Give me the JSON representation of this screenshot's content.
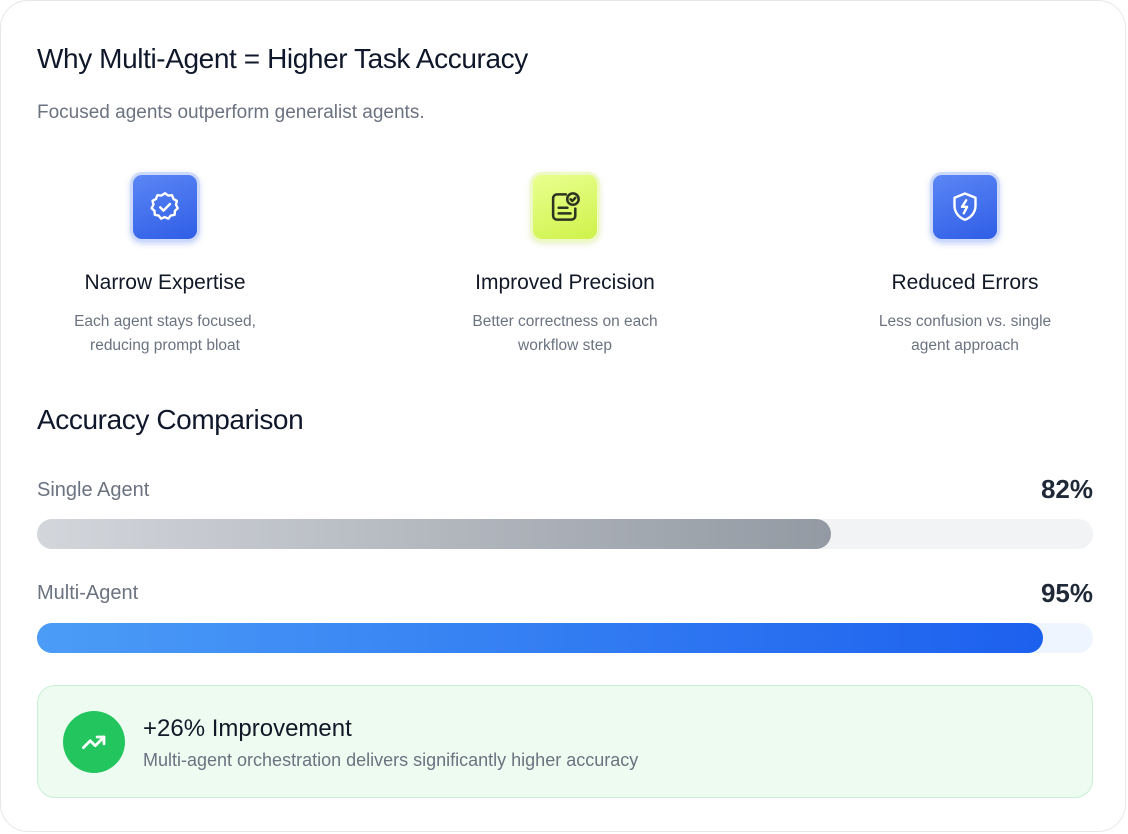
{
  "header": {
    "title": "Why Multi-Agent = Higher Task Accuracy",
    "subtitle": "Focused agents outperform generalist agents."
  },
  "features": [
    {
      "icon": "badge-check-icon",
      "title": "Narrow Expertise",
      "desc_line1": "Each agent stays focused,",
      "desc_line2": "reducing prompt bloat",
      "icon_bg": "#3f6ff0"
    },
    {
      "icon": "document-check-icon",
      "title": "Improved Precision",
      "desc_line1": "Better correctness on each",
      "desc_line2": "workflow step",
      "icon_bg": "#dcf86a"
    },
    {
      "icon": "shield-bolt-icon",
      "title": "Reduced Errors",
      "desc_line1": "Less confusion vs. single",
      "desc_line2": "agent approach",
      "icon_bg": "#3f6ff0"
    }
  ],
  "comparison": {
    "title": "Accuracy Comparison",
    "bars": [
      {
        "label": "Single Agent",
        "value_text": "82%",
        "fill_fraction": 0.752,
        "color": "#939aa3"
      },
      {
        "label": "Multi-Agent",
        "value_text": "95%",
        "fill_fraction": 0.953,
        "color": "#1c60ee"
      }
    ]
  },
  "improvement": {
    "icon": "trending-up-icon",
    "title": "+26% Improvement",
    "desc": "Multi-agent orchestration delivers significantly higher accuracy",
    "accent": "#22c55e"
  }
}
